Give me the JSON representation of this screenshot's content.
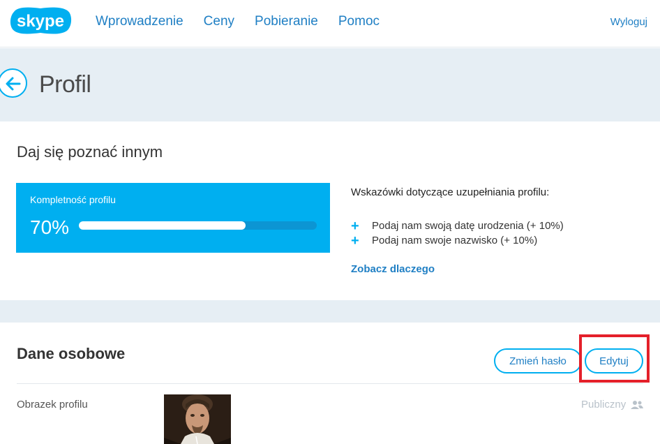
{
  "header": {
    "logo_text": "skype",
    "nav": [
      "Wprowadzenie",
      "Ceny",
      "Pobieranie",
      "Pomoc"
    ],
    "logout": "Wyloguj"
  },
  "page": {
    "title": "Profil",
    "back_icon": "arrow-left-icon"
  },
  "completeness": {
    "heading": "Daj się poznać innym",
    "label": "Kompletność profilu",
    "percent_text": "70%",
    "percent_value": 0.7,
    "tips_title": "Wskazówki dotyczące uzupełniania profilu:",
    "tips": [
      "Podaj nam swoją datę urodzenia (+ 10%)",
      "Podaj nam swoje nazwisko (+ 10%)"
    ],
    "why_link": "Zobacz dlaczego"
  },
  "personal": {
    "heading": "Dane osobowe",
    "change_password": "Zmień hasło",
    "edit": "Edytuj",
    "picture_label": "Obrazek profilu",
    "visibility": "Publiczny",
    "visibility_icon": "people-icon"
  },
  "colors": {
    "accent": "#00aff0",
    "link": "#1f7fc4",
    "band": "#e6eef4",
    "highlight": "#e4202a"
  }
}
